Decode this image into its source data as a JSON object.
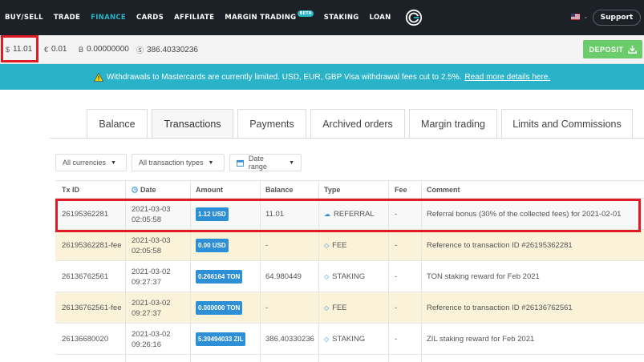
{
  "nav": {
    "items": [
      {
        "label": "BUY/SELL"
      },
      {
        "label": "TRADE"
      },
      {
        "label": "FINANCE"
      },
      {
        "label": "CARDS"
      },
      {
        "label": "AFFILIATE"
      },
      {
        "label": "MARGIN TRADING",
        "badge": "BETA"
      },
      {
        "label": "STAKING"
      },
      {
        "label": "LOAN"
      }
    ],
    "support_label": "Support",
    "accent_color": "#25b4c3"
  },
  "balances": {
    "usd": {
      "symbol": "$",
      "value": "11.01"
    },
    "eur": {
      "symbol": "€",
      "value": "0.01"
    },
    "btc": {
      "symbol": "B",
      "value": "0.00000000"
    },
    "other": {
      "symbol": "Ⓢ",
      "value": "386.40330236"
    }
  },
  "deposit_label": "DEPOSIT",
  "notice": {
    "text": "Withdrawals to Mastercards are currently limited. USD, EUR, GBP Visa withdrawal fees cut to 2.5%.",
    "link": " Read more details here."
  },
  "tabs": [
    "Balance",
    "Transactions",
    "Payments",
    "Archived orders",
    "Margin trading",
    "Limits and Commissions"
  ],
  "filters": {
    "currencies": "All currencies",
    "types": "All transaction types",
    "date": "Date range"
  },
  "table": {
    "headers": [
      "Tx ID",
      "Date",
      "Amount",
      "Balance",
      "Type",
      "Fee",
      "Comment"
    ],
    "rows": [
      {
        "txid": "26195362281",
        "date": "2021-03-03",
        "time": "02:05:58",
        "amount": "1.12 USD",
        "balance": "11.01",
        "type": "REFERRAL",
        "fee": "-",
        "comment": "Referral bonus (30% of the collected fees) for 2021-02-01"
      },
      {
        "txid": "26195362281-fee",
        "date": "2021-03-03",
        "time": "02:05:58",
        "amount": "0.00 USD",
        "balance": "-",
        "type": "FEE",
        "fee": "-",
        "comment": "Reference to transaction ID #26195362281"
      },
      {
        "txid": "26136762561",
        "date": "2021-03-02",
        "time": "09:27:37",
        "amount": "0.266164 TON",
        "balance": "64.980449",
        "type": "STAKING",
        "fee": "-",
        "comment": "TON staking reward for Feb 2021"
      },
      {
        "txid": "26136762561-fee",
        "date": "2021-03-02",
        "time": "09:27:37",
        "amount": "0.000000 TON",
        "balance": "-",
        "type": "FEE",
        "fee": "-",
        "comment": "Reference to transaction ID #26136762561"
      },
      {
        "txid": "26136680020",
        "date": "2021-03-02",
        "time": "09:26:16",
        "amount": "5.39494033 ZIL",
        "balance": "386.40330236",
        "type": "STAKING",
        "fee": "-",
        "comment": "ZIL staking reward for Feb 2021"
      }
    ]
  },
  "colors": {
    "highlight": "#e01b24",
    "deposit": "#6bcc6b",
    "notice_bg": "#2ab3c8",
    "fee_row": "#faf3da",
    "amount_badge": "#2d8fd6"
  }
}
